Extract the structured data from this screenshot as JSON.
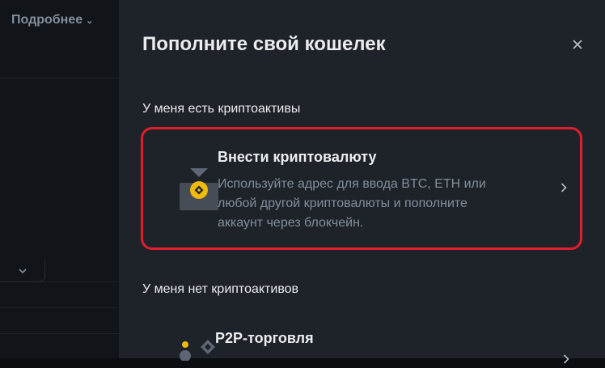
{
  "left_pane": {
    "more_label": "Подробнее"
  },
  "drawer": {
    "title": "Пополните свой кошелек",
    "close_icon": "close-icon",
    "section_have": "У меня есть криптоактивы",
    "deposit": {
      "title": "Внести криптовалюту",
      "description": "Используйте адрес для ввода BTC, ETH или любой другой криптовалюты и пополните аккаунт через блокчейн.",
      "icon": "deposit-coin-icon"
    },
    "section_have_not": "У меня нет криптоактивов",
    "p2p": {
      "title": "P2P-торговля",
      "icon": "p2p-icon"
    }
  },
  "colors": {
    "accent": "#f0b90b",
    "highlight_border": "#e11d2e",
    "drawer_bg": "#1e2329",
    "page_bg": "#0b0e11"
  }
}
